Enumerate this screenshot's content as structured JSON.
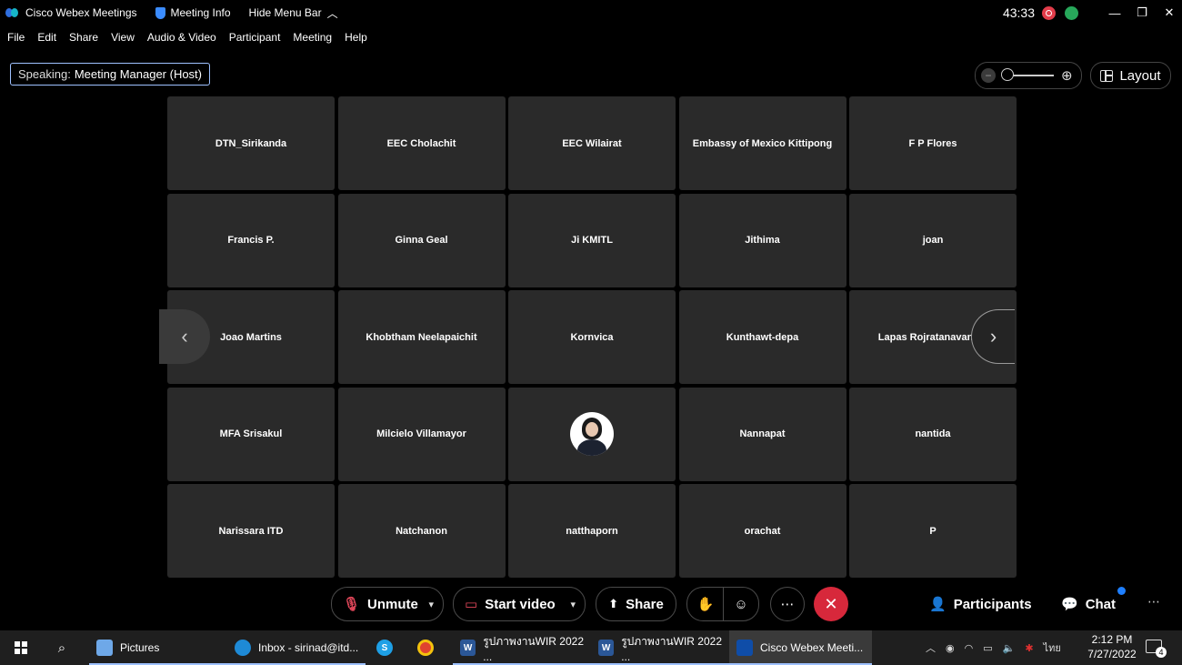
{
  "titlebar": {
    "app_name": "Cisco Webex Meetings",
    "meeting_info": "Meeting Info",
    "hide_menu_bar": "Hide Menu Bar",
    "timer": "43:33"
  },
  "menu": [
    "File",
    "Edit",
    "Share",
    "View",
    "Audio & Video",
    "Participant",
    "Meeting",
    "Help"
  ],
  "speaking": {
    "label": "Speaking:",
    "name": "Meeting Manager (Host)"
  },
  "layout_button": "Layout",
  "participants_grid": [
    "DTN_Sirikanda",
    "EEC Cholachit",
    "EEC Wilairat",
    "Embassy of Mexico Kittipong",
    "F P Flores",
    "Francis P.",
    "Ginna Geal",
    "Ji KMITL",
    "Jithima",
    "joan",
    "Joao Martins",
    "Khobtham Neelapaichit",
    "Kornvica",
    "Kunthawt-depa",
    "Lapas Rojratanavanich",
    "MFA Srisakul",
    "Milcielo Villamayor",
    "",
    "Nannapat",
    "nantida",
    "Narissara ITD",
    "Natchanon",
    "natthaporn",
    "orachat",
    "P"
  ],
  "controls": {
    "unmute": "Unmute",
    "start_video": "Start video",
    "share": "Share",
    "participants": "Participants",
    "chat": "Chat"
  },
  "taskbar": {
    "pictures": "Pictures",
    "inbox": "Inbox - sirinad@itd...",
    "word1": "รูปภาพงานWIR 2022 ...",
    "word2": "รูปภาพงานWIR 2022 ...",
    "webex": "Cisco Webex Meeti...",
    "lang": "ไทย",
    "time": "2:12 PM",
    "date": "7/27/2022",
    "notifications": "4"
  },
  "colors": {
    "accent": "#9ec1ff",
    "leave": "#d7283b",
    "mute_red": "#e2475a",
    "tile": "#2a2a2a"
  }
}
